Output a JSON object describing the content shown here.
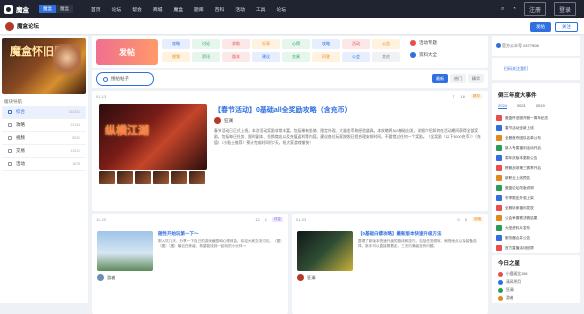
{
  "nav": {
    "logo": "魔盒",
    "switch": [
      "魔盒",
      "魔盒"
    ],
    "links": [
      "首页",
      "论坛",
      "帮会",
      "商城",
      "魔盒",
      "题库",
      "百科",
      "活动",
      "工具",
      "论坛"
    ],
    "icons": [
      "search-icon",
      "edit-icon",
      "bell-icon",
      "mail-icon"
    ],
    "login": "注册",
    "register": "登录"
  },
  "subbar": {
    "forum": "魔盒论坛",
    "btn_primary": "发帖",
    "btn_outline": "关注"
  },
  "left": {
    "banner_title": "魔盒怀旧服",
    "section": "版块导航",
    "items": [
      {
        "label": "综合",
        "count": "134321",
        "active": true
      },
      {
        "label": "攻略",
        "count": "21134"
      },
      {
        "label": "视频",
        "count": "5532"
      },
      {
        "label": "交易",
        "count": "12211"
      },
      {
        "label": "活动",
        "count": "1678"
      }
    ]
  },
  "topbox": {
    "post": "发帖",
    "tags": [
      {
        "label": "攻略",
        "color": "#2f6fe0",
        "bg": "#e7efff"
      },
      {
        "label": "讨论",
        "color": "#2e9b5c",
        "bg": "#e6f6ed"
      },
      {
        "label": "求助",
        "color": "#d9534f",
        "bg": "#fde8e8"
      },
      {
        "label": "分享",
        "color": "#e08a1e",
        "bg": "#fff2df"
      },
      {
        "label": "心得",
        "color": "#2e9b5c",
        "bg": "#e6f6ed"
      },
      {
        "label": "攻略",
        "color": "#2f6fe0",
        "bg": "#e7efff"
      },
      {
        "label": "活动",
        "color": "#d9534f",
        "bg": "#fde8e8"
      },
      {
        "label": "公告",
        "color": "#e08a1e",
        "bg": "#fff2df"
      },
      {
        "label": "视频",
        "color": "#e08a1e",
        "bg": "#fff2df"
      },
      {
        "label": "资讯",
        "color": "#2e9b5c",
        "bg": "#e6f6ed"
      },
      {
        "label": "版本",
        "color": "#d9534f",
        "bg": "#fde8e8"
      },
      {
        "label": "建议",
        "color": "#2f6fe0",
        "bg": "#e7efff"
      },
      {
        "label": "交易",
        "color": "#2e9b5c",
        "bg": "#e6f6ed"
      },
      {
        "label": "问答",
        "color": "#e08a1e",
        "bg": "#fff2df"
      },
      {
        "label": "公会",
        "color": "#2f6fe0",
        "bg": "#e7efff"
      },
      {
        "label": "其他",
        "color": "#888888",
        "bg": "#f1f2f4"
      }
    ],
    "right": [
      {
        "label": "活动专题",
        "color": "#e94e4e"
      },
      {
        "label": "资料大全",
        "color": "#2f6fe0"
      }
    ]
  },
  "search": {
    "placeholder": "搜帖帖子",
    "sort": [
      {
        "label": "最新",
        "active": true
      },
      {
        "label": "热门"
      },
      {
        "label": "精华"
      }
    ]
  },
  "post": {
    "time": "01-13",
    "views": "7",
    "replies": "16",
    "badge": "精华",
    "image_text": "纵横江湖",
    "title": "【春节活动】0基础all全奖励攻略（含充币）",
    "author": "狂澜",
    "body": "春节活动已正式上线，本次活动奖励非常丰富，包括稀有坐骑、限定外观、大量金币和经验道具。本攻略将从0基础出发，详细介绍如何在活动期间获得全部奖励，包括每日任务、限时副本、兑换商店以及充值返利等内容。建议各位玩家按照日程合理安排时间，不要错过任何一个奖励。（全奖励（以下3000充币））（充值）（小贴士推荐）预计完成时间约7天，祝大家游戏愉快！"
  },
  "mini": [
    {
      "time": "11-20",
      "views": "12",
      "replies": "1",
      "badge": "讨论",
      "title": "随性开始玩第一下～",
      "body": "刚入坑几天，分享一下自己的游戏截图和心得体会，欢迎大家交流讨论。（图）（图）（图）最近在练级，希望能找到一起玩的小伙伴～",
      "author": "游者"
    },
    {
      "time": "01-03",
      "views": "0",
      "replies": "5",
      "badge": "攻略",
      "title": "【0基础白嫖攻略】最新版本快速升级方法",
      "body": "整理了新版本快速升级的路线和技巧，包括任务顺序、刷怪地点以及装备选择，新手可以直接照着走，三天内满级没有问题。",
      "author": "狂澜"
    }
  ],
  "right": {
    "ad": "官方公众号 2477908",
    "qr": "扫码关注我们",
    "events_title": "倒三年度大事件",
    "events_tabs": [
      "2024",
      "2021",
      "2019"
    ],
    "events": [
      {
        "label": "魔盒怀旧服开服一周年纪念",
        "color": "#e94e4e"
      },
      {
        "label": "春节活动全新上线",
        "color": "#2f6fe0"
      },
      {
        "label": "全服首杀团队名单公布",
        "color": "#e08a1e"
      },
      {
        "label": "新人专属福利活动开启",
        "color": "#2e9b5c"
      },
      {
        "label": "周年庆版本更新公告",
        "color": "#2f6fe0"
      },
      {
        "label": "跨服战场第三赛季开启",
        "color": "#e94e4e"
      },
      {
        "label": "新职业上线预告",
        "color": "#e08a1e"
      },
      {
        "label": "魔盒论坛改版说明",
        "color": "#2e9b5c"
      },
      {
        "label": "冬季限定外观上架",
        "color": "#2f6fe0"
      },
      {
        "label": "全服玩家福利发放",
        "color": "#e94e4e"
      },
      {
        "label": "公会争霸赛决赛结果",
        "color": "#e08a1e"
      },
      {
        "label": "大型资料片发布",
        "color": "#2e9b5c"
      },
      {
        "label": "服务器合并公告",
        "color": "#2f6fe0"
      },
      {
        "label": "官方直播活动回顾",
        "color": "#e94e4e"
      },
      {
        "label": "玩家创作大赛获奖作品",
        "color": "#e08a1e"
      },
      {
        "label": "年度总结与展望",
        "color": "#2e9b5c"
      }
    ],
    "today_title": "今日之星",
    "today": [
      {
        "label": "小鹿斑比156",
        "color": "#e94e4e"
      },
      {
        "label": "清风明月",
        "color": "#2f6fe0"
      },
      {
        "label": "狂澜",
        "color": "#2e9b5c"
      },
      {
        "label": "游者",
        "color": "#e08a1e"
      }
    ]
  }
}
